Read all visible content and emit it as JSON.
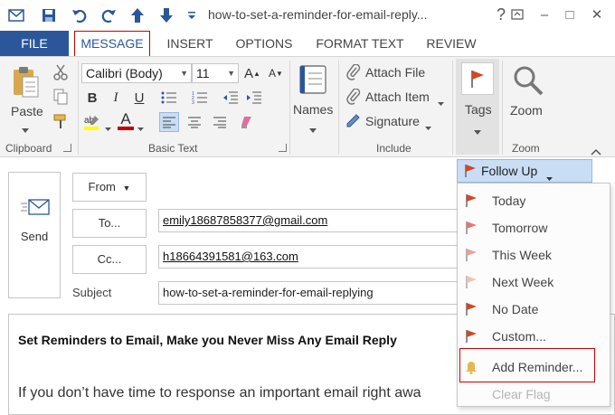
{
  "window": {
    "title": "how-to-set-a-reminder-for-email-reply...",
    "help_label": "?",
    "min_label": "–",
    "max_label": "□",
    "close_label": "✕"
  },
  "tabs": [
    {
      "label": "FILE"
    },
    {
      "label": "MESSAGE"
    },
    {
      "label": "INSERT"
    },
    {
      "label": "OPTIONS"
    },
    {
      "label": "FORMAT TEXT"
    },
    {
      "label": "REVIEW"
    }
  ],
  "ribbon": {
    "clipboard": {
      "label": "Clipboard",
      "paste_label": "Paste"
    },
    "basic_text": {
      "label": "Basic Text",
      "font": "Calibri (Body)",
      "size": "11",
      "bold": "B",
      "italic": "I",
      "underline": "U",
      "font_color": "A"
    },
    "names": {
      "label": "Names"
    },
    "include": {
      "label": "Include",
      "attach_file": "Attach File",
      "attach_item": "Attach Item",
      "signature": "Signature"
    },
    "tags": {
      "label": "Tags"
    },
    "zoom": {
      "label": "Zoom",
      "button": "Zoom"
    }
  },
  "compose": {
    "send_label": "Send",
    "from_label": "From",
    "to_label": "To...",
    "cc_label": "Cc...",
    "subject_label": "Subject",
    "to_value": "emily18687858377@gmail.com",
    "cc_value": "h18664391581@163.com",
    "subject_value": "how-to-set-a-reminder-for-email-replying"
  },
  "body": {
    "heading": "Set Reminders to Email, Make you Never Miss Any Email Reply",
    "text": "If you don’t have time to response an important email right awa"
  },
  "follow_up": {
    "label": "Follow Up",
    "items": [
      {
        "label": "Today"
      },
      {
        "label": "Tomorrow"
      },
      {
        "label": "This Week"
      },
      {
        "label": "Next Week"
      },
      {
        "label": "No Date"
      },
      {
        "label": "Custom..."
      },
      {
        "label": "Add Reminder..."
      },
      {
        "label": "Clear Flag"
      }
    ]
  },
  "colors": {
    "accent": "#2b579a",
    "highlight": "#c00000",
    "flag_red": "#d24726",
    "menu_hover": "#c9def5"
  }
}
